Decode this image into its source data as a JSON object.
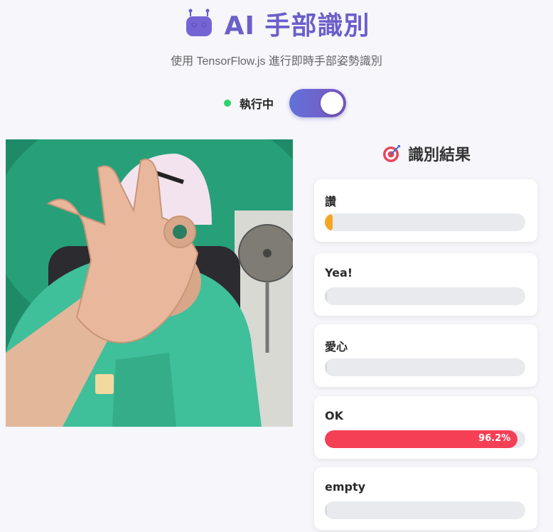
{
  "header": {
    "title": "AI 手部識別",
    "subtitle": "使用 TensorFlow.js 進行即時手部姿勢識別",
    "icon": "robot-icon"
  },
  "status": {
    "label": "執行中",
    "running": true,
    "dot_color": "#2fd16a"
  },
  "results": {
    "title": "識別結果",
    "icon": "target-icon",
    "items": [
      {
        "label": "讚",
        "value": 0.04,
        "pct_text": "",
        "color": "#f5a623"
      },
      {
        "label": "Yea!",
        "value": 0.0,
        "pct_text": "",
        "color": "#4a90e2"
      },
      {
        "label": "愛心",
        "value": 0.0,
        "pct_text": "",
        "color": "#e056a0"
      },
      {
        "label": "OK",
        "value": 0.962,
        "pct_text": "96.2%",
        "color": "#f43f54"
      },
      {
        "label": "empty",
        "value": 0.0,
        "pct_text": "",
        "color": "#8e8e9e"
      }
    ]
  },
  "colors": {
    "accent": "#6b5fc9",
    "toggle_start": "#6272d9",
    "toggle_end": "#7b55c0",
    "track": "#e8eaee"
  }
}
